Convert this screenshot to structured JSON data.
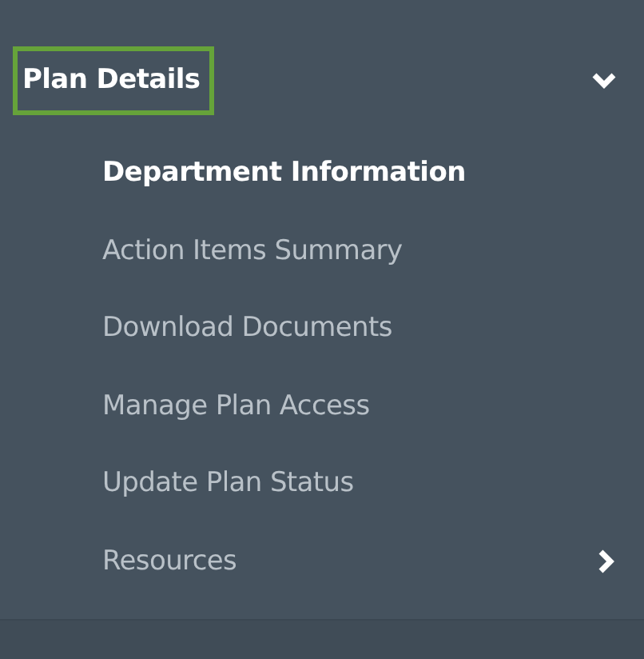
{
  "section": {
    "label": "Plan Details",
    "focused": true,
    "expanded": true
  },
  "items": [
    {
      "label": "Department Information",
      "selected": true,
      "has_submenu": false
    },
    {
      "label": "Action Items Summary",
      "selected": false,
      "has_submenu": false
    },
    {
      "label": "Download Documents",
      "selected": false,
      "has_submenu": false
    },
    {
      "label": "Manage Plan Access",
      "selected": false,
      "has_submenu": false
    },
    {
      "label": "Update Plan Status",
      "selected": false,
      "has_submenu": false
    },
    {
      "label": "Resources",
      "selected": false,
      "has_submenu": true
    }
  ]
}
